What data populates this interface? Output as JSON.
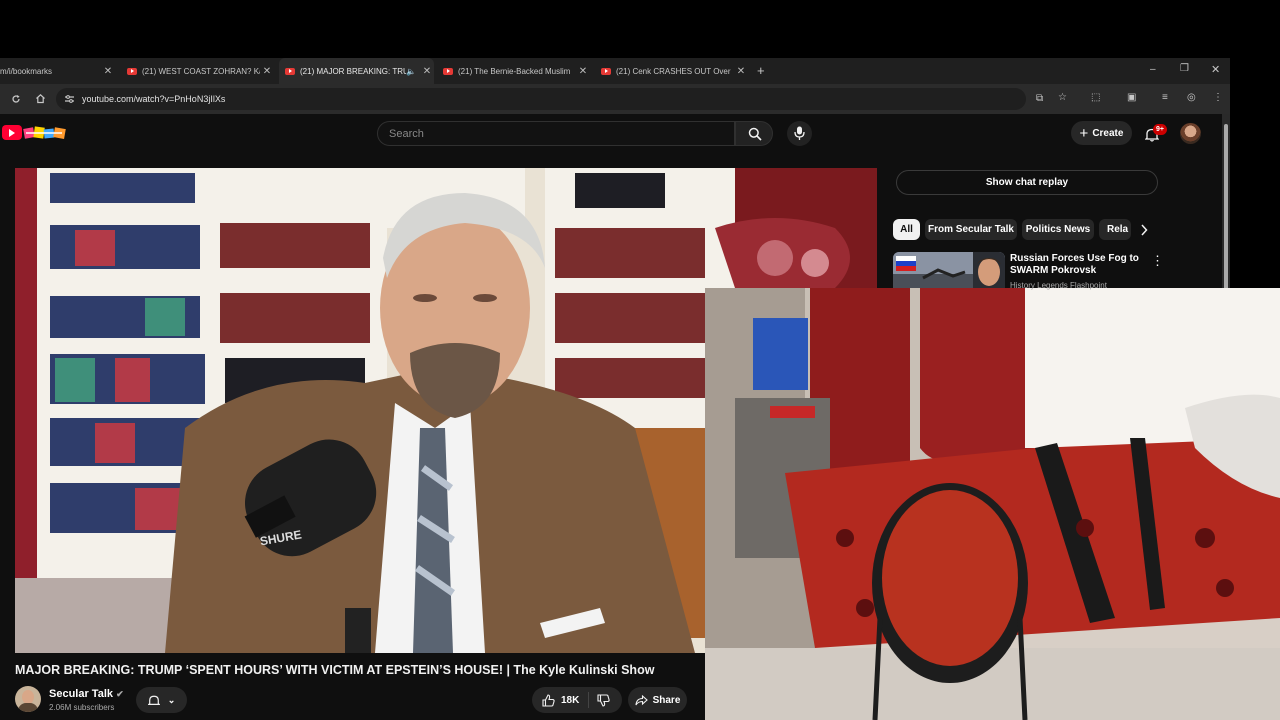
{
  "browser": {
    "tabs": [
      {
        "title": "m/i/bookmarks",
        "active": false,
        "favicon": "bookmark"
      },
      {
        "title": "(21) WEST COAST ZOHRAN? Ka",
        "active": false,
        "favicon": "youtube"
      },
      {
        "title": "(21) MAJOR BREAKING: TRU",
        "active": true,
        "favicon": "youtube",
        "audio": true
      },
      {
        "title": "(21) The Bernie-Backed Muslim",
        "active": false,
        "favicon": "youtube"
      },
      {
        "title": "(21) Cenk CRASHES OUT Over",
        "active": false,
        "favicon": "youtube"
      }
    ],
    "url": "youtube.com/watch?v=PnHoN3jIlXs",
    "icons": [
      "reload-icon",
      "home-icon",
      "site-info-icon",
      "cast-icon",
      "star-icon",
      "extensions-icon",
      "sidepanel-icon",
      "media-icon",
      "profile-icon",
      "menu-icon"
    ]
  },
  "youtube": {
    "search_placeholder": "Search",
    "create_label": "Create",
    "notification_count": "9+",
    "video_title": "MAJOR BREAKING: TRUMP ‘SPENT HOURS’ WITH VICTIM AT EPSTEIN’S HOUSE! | The Kyle Kulinski Show",
    "channel_name": "Secular Talk",
    "subscribers": "2.06M subscribers",
    "likes": "18K",
    "share_label": "Share",
    "show_chat_replay": "Show chat replay",
    "chips": [
      "All",
      "From Secular Talk",
      "Politics News",
      "Rela"
    ],
    "recommendation": {
      "title": "Russian Forces Use Fog to SWARM Pokrovsk",
      "channel": "History Legends Flashpoint"
    },
    "colors": {
      "brand_red": "#ff0033",
      "background": "#0f0f0f"
    }
  }
}
